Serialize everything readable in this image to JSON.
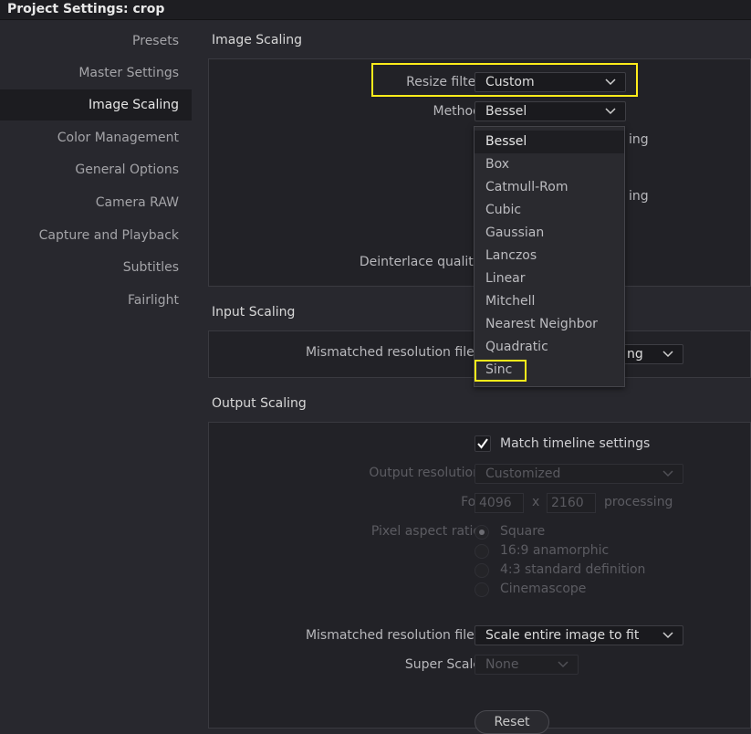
{
  "window": {
    "title": "Project Settings:  crop"
  },
  "sidebar": {
    "items": [
      {
        "label": "Presets"
      },
      {
        "label": "Master Settings"
      },
      {
        "label": "Image Scaling",
        "active": true
      },
      {
        "label": "Color Management"
      },
      {
        "label": "General Options"
      },
      {
        "label": "Camera RAW"
      },
      {
        "label": "Capture and Playback"
      },
      {
        "label": "Subtitles"
      },
      {
        "label": "Fairlight"
      }
    ]
  },
  "image_scaling": {
    "title": "Image Scaling",
    "resize_filter_label": "Resize filter",
    "resize_filter_value": "Custom",
    "method_label": "Method",
    "method_value": "Bessel",
    "deinterlace_label": "Deinterlace quality",
    "hidden_text_1": "ing",
    "hidden_text_2": "ing"
  },
  "method_menu": {
    "options": [
      "Bessel",
      "Box",
      "Catmull-Rom",
      "Cubic",
      "Gaussian",
      "Lanczos",
      "Linear",
      "Mitchell",
      "Nearest Neighbor",
      "Quadratic",
      "Sinc"
    ],
    "selected": "Bessel",
    "highlighted": "Sinc"
  },
  "input_scaling": {
    "title": "Input Scaling",
    "mismatched_label": "Mismatched resolution files",
    "mismatched_partial": "ng"
  },
  "output_scaling": {
    "title": "Output Scaling",
    "match_timeline_label": "Match timeline settings",
    "match_timeline_checked": true,
    "output_resolution_label": "Output resolution",
    "output_resolution_value": "Customized",
    "for_label": "For",
    "width": "4096",
    "x_label": "x",
    "height": "2160",
    "processing_label": "processing",
    "pixel_aspect_label": "Pixel aspect ratio",
    "pixel_aspect_options": [
      "Square",
      "16:9 anamorphic",
      "4:3 standard definition",
      "Cinemascope"
    ],
    "pixel_aspect_selected": "Square",
    "mismatched_label": "Mismatched resolution files",
    "mismatched_value": "Scale entire image to fit",
    "super_scale_label": "Super Scale",
    "super_scale_value": "None",
    "reset_label": "Reset"
  },
  "colors": {
    "highlight": "#ffec1a",
    "background": "#28282e",
    "panel": "#222227"
  },
  "icons": {
    "dropdown": "chevron-down-icon",
    "check": "checkmark-icon"
  }
}
